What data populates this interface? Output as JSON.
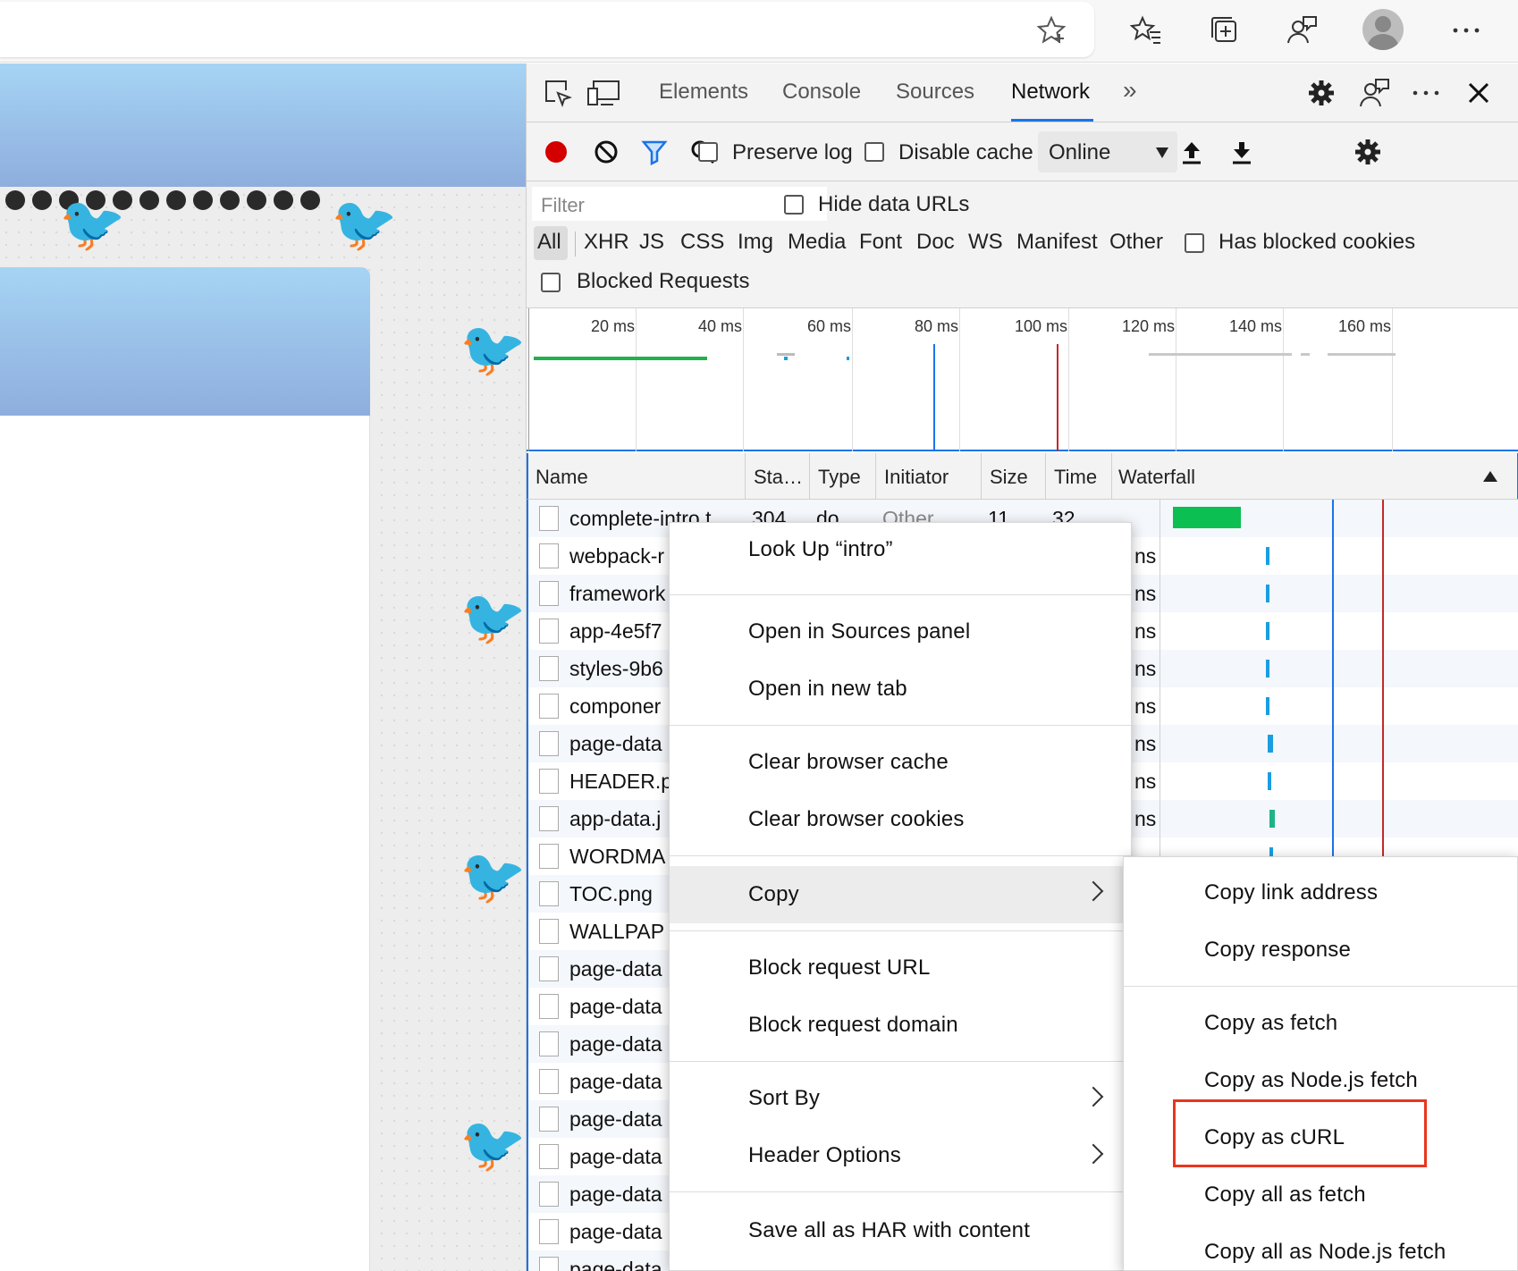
{
  "devtools": {
    "tabs": [
      "Elements",
      "Console",
      "Sources",
      "Network"
    ],
    "active_tab": "Network",
    "more_tabs": "»"
  },
  "toolbar": {
    "preserve_log": "Preserve log",
    "disable_cache": "Disable cache",
    "throttling": "Online"
  },
  "filter": {
    "placeholder": "Filter",
    "hide_data_urls": "Hide data URLs",
    "types": [
      "All",
      "XHR",
      "JS",
      "CSS",
      "Img",
      "Media",
      "Font",
      "Doc",
      "WS",
      "Manifest",
      "Other"
    ],
    "has_blocked_cookies": "Has blocked cookies",
    "blocked_requests": "Blocked Requests"
  },
  "overview": {
    "ticks": [
      "20 ms",
      "40 ms",
      "60 ms",
      "80 ms",
      "100 ms",
      "120 ms",
      "140 ms",
      "160 ms"
    ]
  },
  "table": {
    "columns": [
      "Name",
      "Sta…",
      "Type",
      "Initiator",
      "Size",
      "Time",
      "Waterfall"
    ],
    "first_row": {
      "name": "complete-intro t",
      "status": "304",
      "type": "do",
      "initiator": "Other",
      "size": "11",
      "time": "32 …"
    },
    "rows": [
      "webpack-r",
      "framework",
      "app-4e5f7",
      "styles-9b6",
      "componer",
      "page-data",
      "HEADER.p",
      "app-data.j",
      "WORDMA",
      "TOC.png",
      "WALLPAP",
      "page-data",
      "page-data",
      "page-data",
      "page-data",
      "page-data",
      "page-data",
      "page-data",
      "page-data",
      "page-data"
    ],
    "time_suffix": "ns"
  },
  "context_menu": {
    "items": [
      "Look Up “intro”",
      "Open in Sources panel",
      "Open in new tab",
      "Clear browser cache",
      "Clear browser cookies",
      "Copy",
      "Block request URL",
      "Block request domain",
      "Sort By",
      "Header Options",
      "Save all as HAR with content"
    ]
  },
  "copy_submenu": {
    "items": [
      "Copy link address",
      "Copy response",
      "Copy as fetch",
      "Copy as Node.js fetch",
      "Copy as cURL",
      "Copy all as fetch",
      "Copy all as Node.js fetch"
    ],
    "highlighted": "Copy as cURL"
  },
  "colors": {
    "accent": "#1a73e8",
    "record": "#d40000",
    "filter": "#1a73e8",
    "highlight_box": "#e8361f"
  }
}
